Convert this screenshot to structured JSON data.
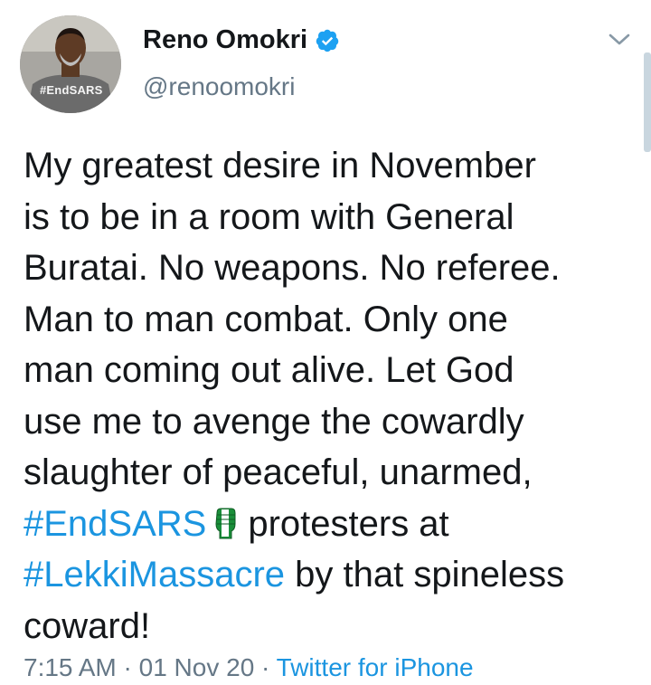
{
  "user": {
    "display_name": "Reno Omokri",
    "handle": "@renoomokri",
    "avatar_shirt_text": "#EndSARS",
    "verified": true
  },
  "tweet": {
    "lines": [
      "My greatest desire in November",
      "is to be in a room with General",
      "Buratai. No weapons. No referee.",
      "Man to man combat. Only one",
      "man coming out alive. Let God",
      "use me to avenge the cowardly",
      "slaughter of peaceful, unarmed,"
    ],
    "hashtag_endsars": "#EndSARS",
    "after_endsars": "protesters at",
    "hashtag_lekki": "#LekkiMassacre",
    "after_lekki": " by that spineless",
    "last_line": "coward!",
    "emoji_name": "raised-fist-emoji"
  },
  "meta": {
    "time": "7:15 AM",
    "date": "01 Nov 20",
    "source": "Twitter for iPhone",
    "separator": " · "
  },
  "colors": {
    "link": "#1b95e0",
    "secondary_text": "#657786",
    "primary_text": "#14171a",
    "verified_badge": "#1da1f2"
  }
}
